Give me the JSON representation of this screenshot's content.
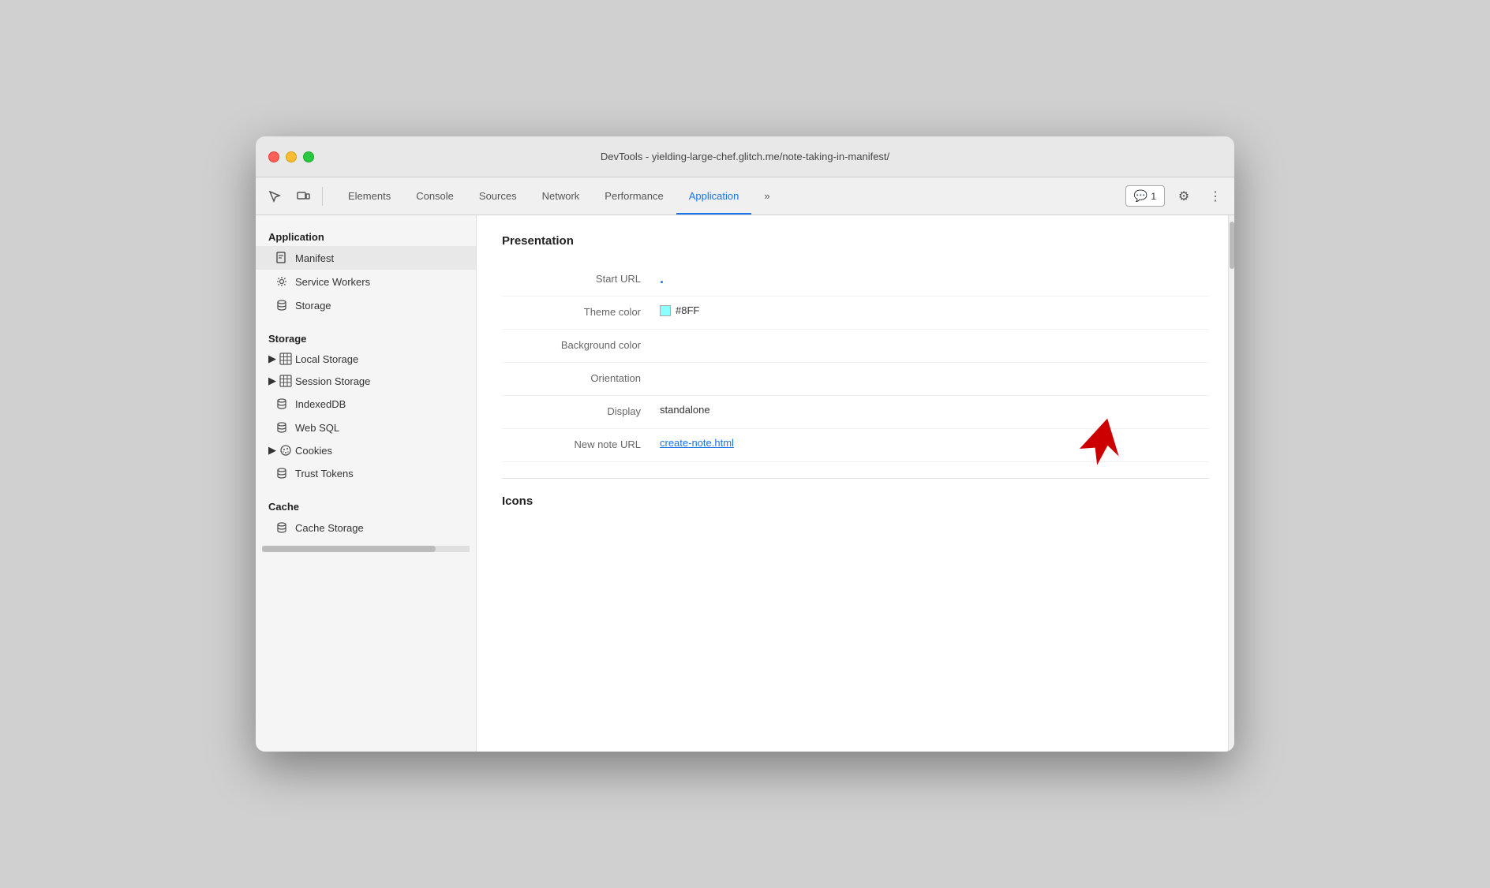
{
  "window": {
    "title": "DevTools - yielding-large-chef.glitch.me/note-taking-in-manifest/"
  },
  "toolbar": {
    "tabs": [
      {
        "id": "elements",
        "label": "Elements",
        "active": false
      },
      {
        "id": "console",
        "label": "Console",
        "active": false
      },
      {
        "id": "sources",
        "label": "Sources",
        "active": false
      },
      {
        "id": "network",
        "label": "Network",
        "active": false
      },
      {
        "id": "performance",
        "label": "Performance",
        "active": false
      },
      {
        "id": "application",
        "label": "Application",
        "active": true
      }
    ],
    "more_label": "»",
    "notification_count": "1",
    "settings_icon": "⚙",
    "more_icon": "⋮"
  },
  "sidebar": {
    "application_section": "Application",
    "application_items": [
      {
        "id": "manifest",
        "label": "Manifest",
        "icon": "manifest",
        "active": true
      },
      {
        "id": "service-workers",
        "label": "Service Workers",
        "icon": "gear"
      },
      {
        "id": "storage",
        "label": "Storage",
        "icon": "db"
      }
    ],
    "storage_section": "Storage",
    "storage_items": [
      {
        "id": "local-storage",
        "label": "Local Storage",
        "icon": "grid",
        "expandable": true
      },
      {
        "id": "session-storage",
        "label": "Session Storage",
        "icon": "grid",
        "expandable": true
      },
      {
        "id": "indexeddb",
        "label": "IndexedDB",
        "icon": "db"
      },
      {
        "id": "web-sql",
        "label": "Web SQL",
        "icon": "db"
      },
      {
        "id": "cookies",
        "label": "Cookies",
        "icon": "cookie",
        "expandable": true
      },
      {
        "id": "trust-tokens",
        "label": "Trust Tokens",
        "icon": "db"
      }
    ],
    "cache_section": "Cache",
    "cache_items": [
      {
        "id": "cache-storage",
        "label": "Cache Storage",
        "icon": "db"
      }
    ]
  },
  "content": {
    "presentation_title": "Presentation",
    "properties": [
      {
        "id": "start-url",
        "label": "Start URL",
        "value": ".",
        "type": "dot"
      },
      {
        "id": "theme-color",
        "label": "Theme color",
        "value": "#8FF",
        "type": "color",
        "color": "#8effff"
      },
      {
        "id": "background-color",
        "label": "Background color",
        "value": "",
        "type": "text"
      },
      {
        "id": "orientation",
        "label": "Orientation",
        "value": "",
        "type": "text"
      },
      {
        "id": "display",
        "label": "Display",
        "value": "standalone",
        "type": "text"
      },
      {
        "id": "new-note-url",
        "label": "New note URL",
        "value": "create-note.html",
        "type": "link"
      }
    ],
    "icons_title": "Icons"
  }
}
